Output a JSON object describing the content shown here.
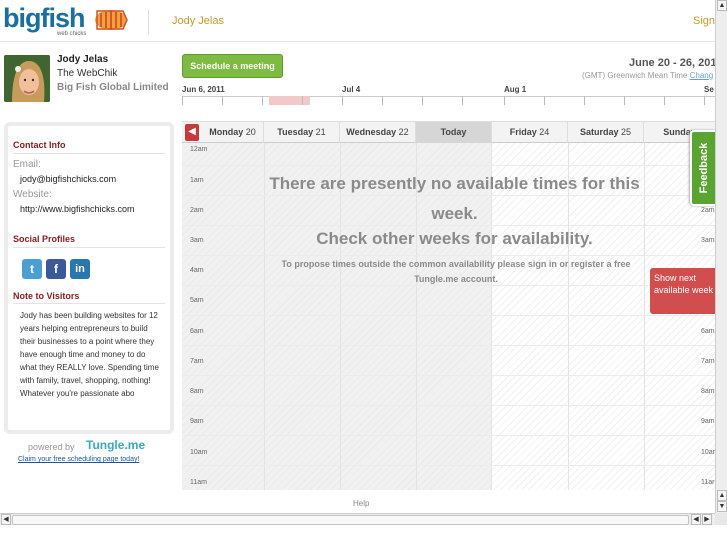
{
  "header": {
    "logo_text": "bigfish",
    "logo_sub": "web chicks",
    "user_name": "Jody Jelas",
    "sign_link": "Sign"
  },
  "profile": {
    "name": "Jody Jelas",
    "title": "The WebChik",
    "company": "Big Fish Global Limited"
  },
  "contact": {
    "heading": "Contact Info",
    "email_label": "Email:",
    "email": "jody@bigfishchicks.com",
    "website_label": "Website:",
    "website": "http://www.bigfishchicks.com"
  },
  "social": {
    "heading": "Social Profiles",
    "icons": [
      "twitter-icon",
      "facebook-icon",
      "linkedin-icon"
    ]
  },
  "note": {
    "heading": "Note to Visitors",
    "text": "Jody has been building websites for 12 years helping entrepreneurs to build their businesses to a point where they have enough time and money to do what they REALLY love. Spending time with family, travel, shopping, nothing! Whatever you're passionate abo"
  },
  "footer": {
    "powered_by": "powered by",
    "brand": "Tungle.me",
    "claim_link": "Claim your free scheduling page today!",
    "help": "Help"
  },
  "toolbar": {
    "schedule_button": "Schedule a meeting",
    "date_range": "June 20 - 26, 201",
    "timezone": "(GMT) Greenwich Mean Time",
    "change_link": "Chang"
  },
  "timeline": {
    "labels": [
      "Jun 6, 2011",
      "Jul 4",
      "Aug 1",
      "Se"
    ]
  },
  "days": [
    {
      "name": "Monday",
      "num": "20"
    },
    {
      "name": "Tuesday",
      "num": "21"
    },
    {
      "name": "Wednesday",
      "num": "22"
    },
    {
      "name": "Today",
      "num": ""
    },
    {
      "name": "Friday",
      "num": "24"
    },
    {
      "name": "Saturday",
      "num": "25"
    },
    {
      "name": "Sunday",
      "num": ""
    }
  ],
  "hours": [
    "12am",
    "1am",
    "2am",
    "3am",
    "4am",
    "5am",
    "6am",
    "7am",
    "8am",
    "9am",
    "10am",
    "11am"
  ],
  "hours_right": [
    "1am",
    "2am",
    "3am",
    "4am",
    "5am",
    "6am",
    "7am",
    "8am",
    "9am",
    "10am",
    "11ar"
  ],
  "message": {
    "line1": "There are presently no available times for this week.",
    "line2": "Check other weeks for availability.",
    "line3": "To propose times outside the common availability please sign in or register a free Tungle.me account."
  },
  "next_week": "Show next available week",
  "feedback": "Feedback",
  "colors": {
    "brand_blue": "#1a6fa0",
    "accent_gold": "#c79a2a",
    "green_button": "#7dbb42",
    "red_accent": "#d24d4d",
    "heading_red": "#8a1c1c"
  }
}
